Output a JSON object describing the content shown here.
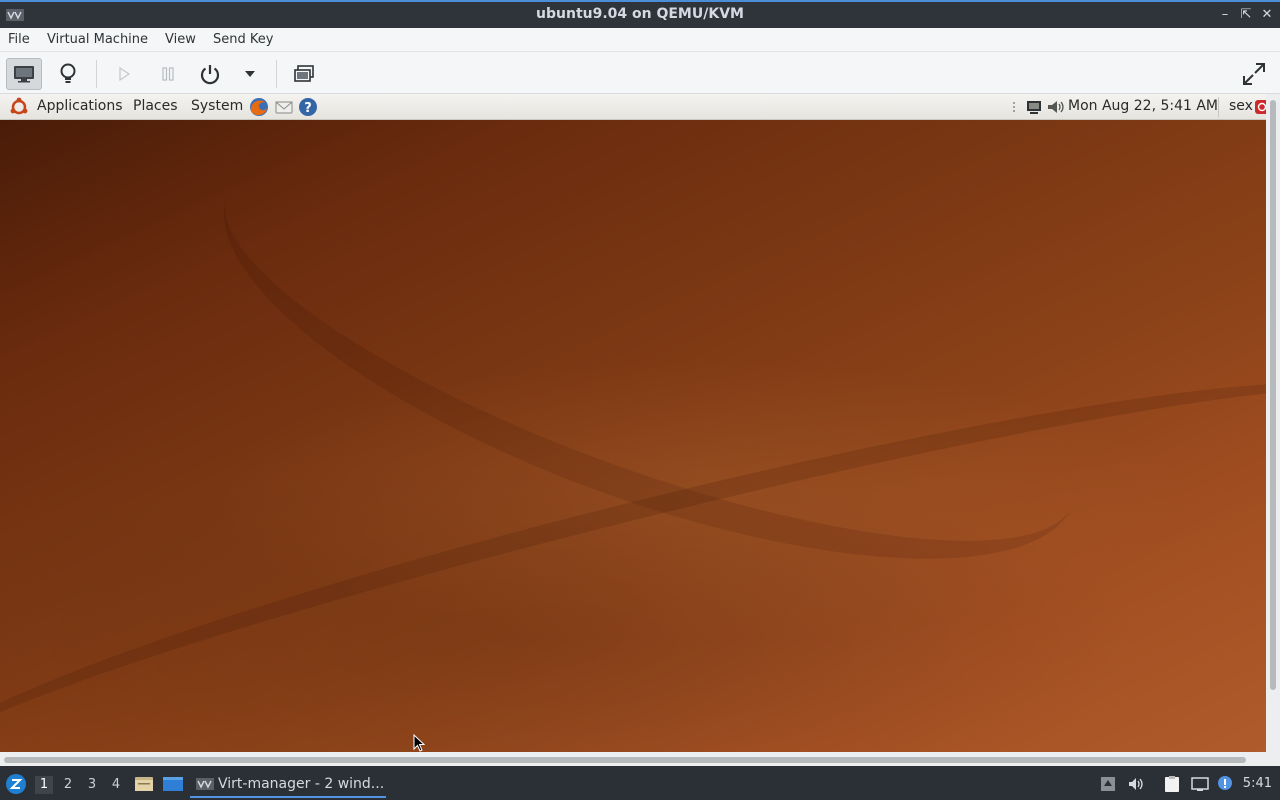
{
  "window": {
    "title": "ubuntu9.04 on QEMU/KVM",
    "icons": {
      "app": "virt-manager-icon",
      "minimize": "minimize-icon",
      "maximize": "maximize-icon",
      "close": "close-icon"
    }
  },
  "menubar": {
    "items": [
      "File",
      "Virtual Machine",
      "View",
      "Send Key"
    ]
  },
  "toolbar": {
    "buttons": [
      {
        "name": "console-button",
        "icon": "monitor-icon"
      },
      {
        "name": "details-button",
        "icon": "lightbulb-icon"
      },
      {
        "name": "run-button",
        "icon": "play-icon"
      },
      {
        "name": "pause-button",
        "icon": "pause-icon"
      },
      {
        "name": "shutdown-button",
        "icon": "power-icon"
      },
      {
        "name": "shutdown-menu-button",
        "icon": "chevron-down-icon"
      },
      {
        "name": "snapshots-button",
        "icon": "snapshots-icon"
      },
      {
        "name": "fullscreen-button",
        "icon": "fullscreen-icon"
      }
    ]
  },
  "guest": {
    "panel": {
      "applications": "Applications",
      "places": "Places",
      "system": "System",
      "datetime": "Mon Aug 22,  5:41 AM",
      "user": "sex"
    }
  },
  "taskbar": {
    "workspaces": [
      "1",
      "2",
      "3",
      "4"
    ],
    "task": "Virt-manager - 2 wind...",
    "clock": "5:41"
  },
  "colors": {
    "accent": "#5294e2",
    "titlebar": "#2f343a",
    "taskbar": "#2b3036"
  }
}
